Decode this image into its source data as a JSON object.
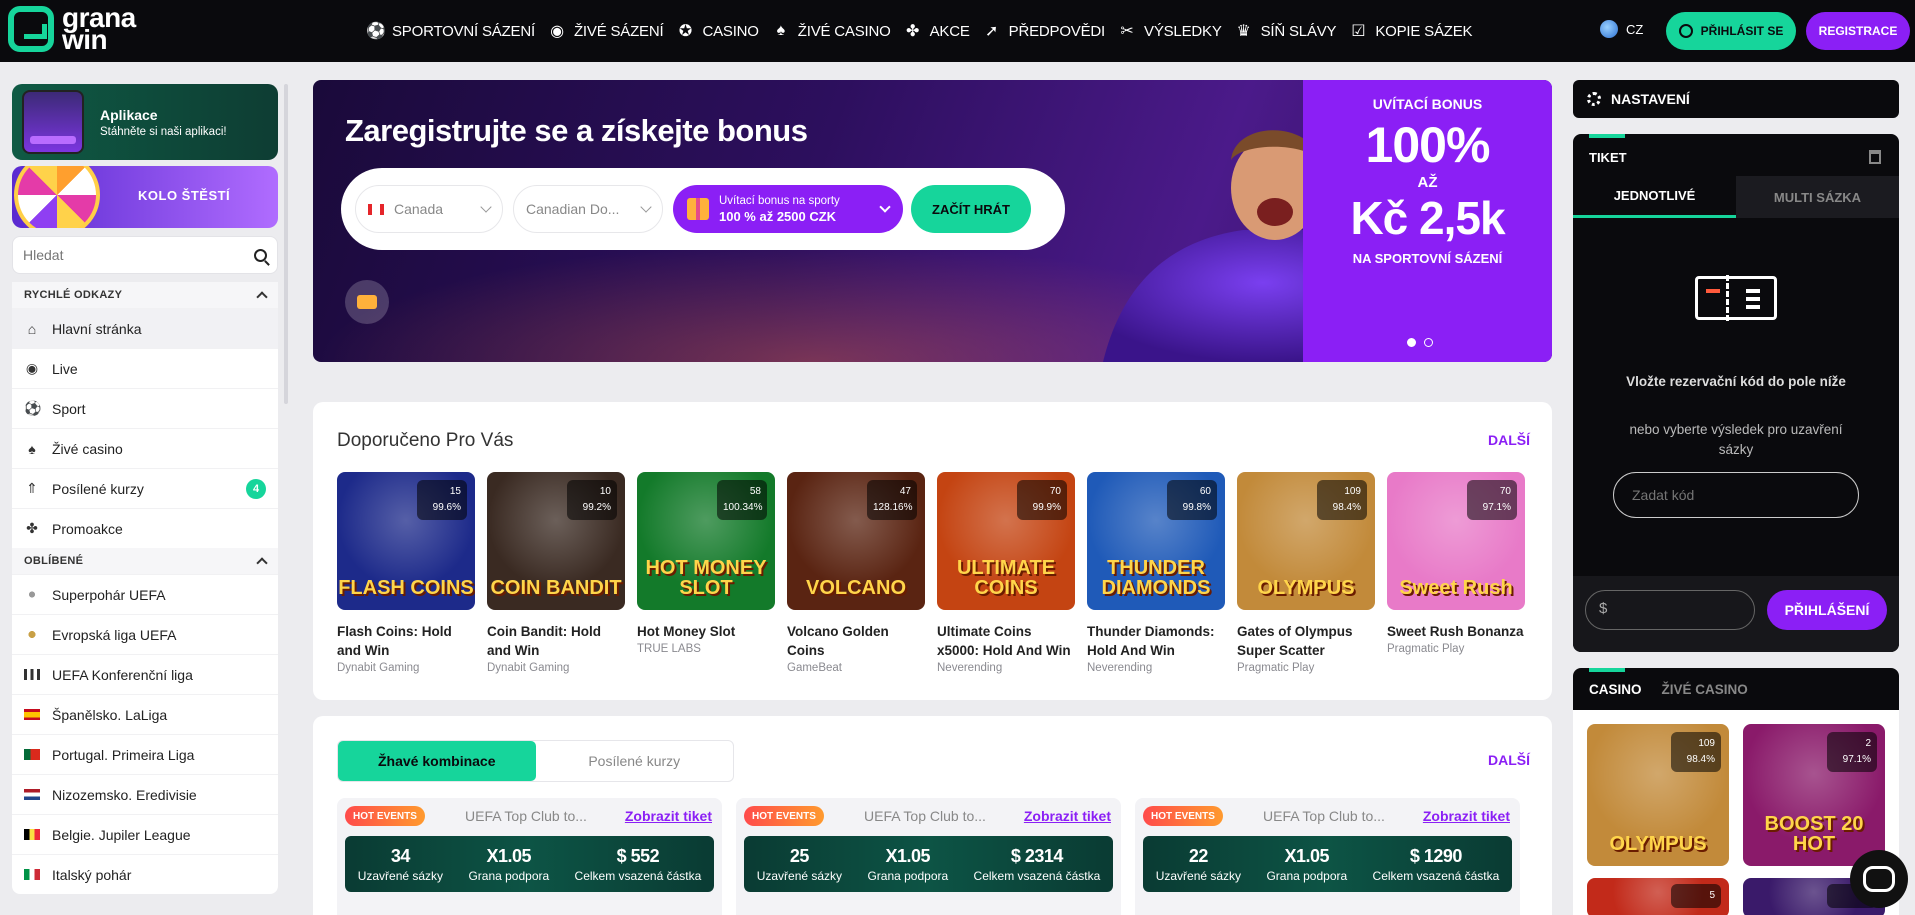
{
  "brand": {
    "line1": "grana",
    "line2": "win",
    "accent": "#16d59b",
    "purple": "#8b1ff5"
  },
  "nav": [
    {
      "label": "SPORTOVNÍ SÁZENÍ",
      "icon": "soccer-ball-icon",
      "glyph": "⚽"
    },
    {
      "label": "ŽIVÉ SÁZENÍ",
      "icon": "live-ball-icon",
      "glyph": "◉"
    },
    {
      "label": "CASINO",
      "icon": "casino-chip-icon",
      "glyph": "✪"
    },
    {
      "label": "ŽIVÉ CASINO",
      "icon": "cards-icon",
      "glyph": "♠"
    },
    {
      "label": "AKCE",
      "icon": "gift-icon",
      "glyph": "✤"
    },
    {
      "label": "PŘEDPOVĚDI",
      "icon": "cursor-icon",
      "glyph": "➚"
    },
    {
      "label": "VÝSLEDKY",
      "icon": "tools-icon",
      "glyph": "✂"
    },
    {
      "label": "SÍŇ SLÁVY",
      "icon": "trophy-icon",
      "glyph": "♛"
    },
    {
      "label": "KOPIE SÁZEK",
      "icon": "copy-icon",
      "glyph": "☑"
    }
  ],
  "header": {
    "lang": "CZ",
    "login": "PŘIHLÁSIT SE",
    "register": "REGISTRACE"
  },
  "sidebar": {
    "app_title": "Aplikace",
    "app_sub": "Stáhněte si naši aplikaci!",
    "wheel": "KOLO ŠTĚSTÍ",
    "search_placeholder": "Hledat",
    "quick_title": "RYCHLÉ ODKAZY",
    "quick": [
      {
        "label": "Hlavní stránka",
        "icon": "home-icon",
        "glyph": "⌂"
      },
      {
        "label": "Live",
        "icon": "live-icon",
        "glyph": "◉"
      },
      {
        "label": "Sport",
        "icon": "soccer-ball-icon",
        "glyph": "⚽"
      },
      {
        "label": "Živé casino",
        "icon": "cards-icon",
        "glyph": "♠"
      },
      {
        "label": "Posílené kurzy",
        "icon": "boost-icon",
        "glyph": "⇑",
        "count": "4"
      },
      {
        "label": "Promoakce",
        "icon": "gift-icon",
        "glyph": "✤"
      }
    ],
    "fav_title": "OBLÍBENÉ",
    "favorites": [
      {
        "label": "Superpohár UEFA",
        "flag": "uefa"
      },
      {
        "label": "Evropská liga UEFA",
        "flag": "europa"
      },
      {
        "label": "UEFA Konferenční liga",
        "flag": "conf"
      },
      {
        "label": "Španělsko. LaLiga",
        "flag": "es"
      },
      {
        "label": "Portugal. Primeira Liga",
        "flag": "pt"
      },
      {
        "label": "Nizozemsko. Eredivisie",
        "flag": "nl"
      },
      {
        "label": "Belgie. Jupiler League",
        "flag": "be"
      },
      {
        "label": "Italský pohár",
        "flag": "it"
      }
    ]
  },
  "hero": {
    "title": "Zaregistrujte se a získejte bonus",
    "country": "Canada",
    "currency": "Canadian Do...",
    "bonus_line1": "Uvítací bonus na sporty",
    "bonus_line2": "100 % až 2500 CZK",
    "play": "ZAČÍT HRÁT",
    "promo_label": "UVÍTACÍ BONUS",
    "promo_pct": "100%",
    "promo_az": "AŽ",
    "promo_amount": "Kč 2,5k",
    "promo_sub": "NA SPORTOVNÍ SÁZENÍ"
  },
  "recommended": {
    "title": "Doporučeno Pro Vás",
    "more": "DALŠÍ",
    "games": [
      {
        "name": "Flash Coins: Hold and Win",
        "provider": "Dynabit Gaming",
        "players": "15",
        "rtp": "99.6%",
        "art": "FLASH COINS",
        "bg": "#1d2a8a"
      },
      {
        "name": "Coin Bandit: Hold and Win",
        "provider": "Dynabit Gaming",
        "players": "10",
        "rtp": "99.2%",
        "art": "COIN BANDIT",
        "bg": "#3a2a22"
      },
      {
        "name": "Hot Money Slot",
        "provider": "TRUE LABS",
        "players": "58",
        "rtp": "100.34%",
        "art": "HOT MONEY SLOT",
        "bg": "#137a2a"
      },
      {
        "name": "Volcano Golden Coins",
        "provider": "GameBeat",
        "players": "47",
        "rtp": "128.16%",
        "art": "VOLCANO",
        "bg": "#5a2412"
      },
      {
        "name": "Ultimate Coins x5000: Hold And Win",
        "provider": "Neverending",
        "players": "70",
        "rtp": "99.9%",
        "art": "ULTIMATE COINS",
        "bg": "#c44412"
      },
      {
        "name": "Thunder Diamonds: Hold And Win",
        "provider": "Neverending",
        "players": "60",
        "rtp": "99.8%",
        "art": "THUNDER DIAMONDS",
        "bg": "#1f5ab8"
      },
      {
        "name": "Gates of Olympus Super Scatter",
        "provider": "Pragmatic Play",
        "players": "109",
        "rtp": "98.4%",
        "art": "OLYMPUS",
        "bg": "#c28a3a"
      },
      {
        "name": "Sweet Rush Bonanza",
        "provider": "Pragmatic Play",
        "players": "70",
        "rtp": "97.1%",
        "art": "Sweet Rush",
        "bg": "#e87ac8"
      }
    ]
  },
  "hot": {
    "tab_active": "Žhavé kombinace",
    "tab_other": "Posílené kurzy",
    "more": "DALŠÍ",
    "combos": [
      {
        "badge": "HOT EVENTS",
        "league": "UEFA Top Club to...",
        "link": "Zobrazit tiket",
        "closed": "34",
        "support": "X1.05",
        "total": "$ 552",
        "k_closed": "Uzavřené sázky",
        "k_support": "Grana podpora",
        "k_total": "Celkem vsazená částka"
      },
      {
        "badge": "HOT EVENTS",
        "league": "UEFA Top Club to...",
        "link": "Zobrazit tiket",
        "closed": "25",
        "support": "X1.05",
        "total": "$ 2314",
        "k_closed": "Uzavřené sázky",
        "k_support": "Grana podpora",
        "k_total": "Celkem vsazená částka"
      },
      {
        "badge": "HOT EVENTS",
        "league": "UEFA Top Club to...",
        "link": "Zobrazit tiket",
        "closed": "22",
        "support": "X1.05",
        "total": "$ 1290",
        "k_closed": "Uzavřené sázky",
        "k_support": "Grana podpora",
        "k_total": "Celkem vsazená částka"
      }
    ]
  },
  "right": {
    "settings": "NASTAVENÍ",
    "ticket": "TIKET",
    "tab_single": "JEDNOTLIVÉ",
    "tab_multi": "MULTI SÁZKA",
    "hint": "Vložte rezervační kód do pole níže",
    "or": "nebo vyberte výsledek pro uzavření sázky",
    "code_placeholder": "Zadat kód",
    "currency": "$",
    "login": "PŘIHLÁŠENÍ",
    "casino_tab": "CASINO",
    "live_casino_tab": "ŽIVÉ CASINO",
    "casino_games": [
      {
        "players": "109",
        "rtp": "98.4%",
        "art": "OLYMPUS",
        "bg": "#c28a3a"
      },
      {
        "players": "2",
        "rtp": "97.1%",
        "art": "BOOST 20 HOT",
        "bg": "#8a1a6a"
      },
      {
        "players": "5",
        "rtp": "",
        "art": "",
        "bg": "#c22a1a"
      },
      {
        "players": "13",
        "rtp": "",
        "art": "",
        "bg": "#3a1a6a"
      }
    ]
  }
}
